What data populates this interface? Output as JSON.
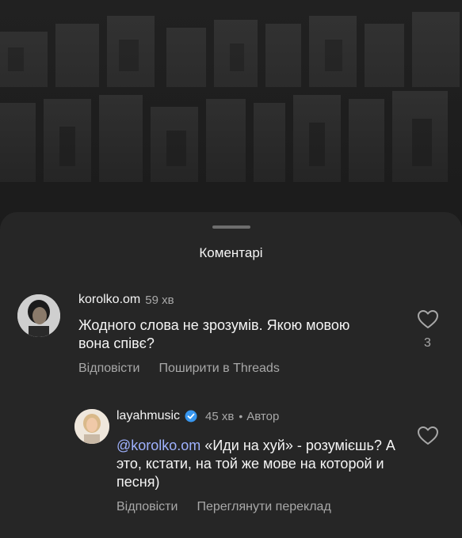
{
  "sheet": {
    "title": "Коментарі"
  },
  "comments": [
    {
      "username": "korolko.om",
      "time": "59 хв",
      "text": "Жодного слова не зрозумів. Якою мовою вона співє?",
      "like_count": "3",
      "actions": [
        "Відповісти",
        "Поширити в Threads"
      ]
    }
  ],
  "reply": {
    "username": "layahmusic",
    "time": "45 хв",
    "author_label": "Автор",
    "separator": "•",
    "mention": "@korolko.om",
    "text": " «Иди на хуй» - розумієшь? А это, кстати, на той же мове на которой и песня)",
    "actions": [
      "Відповісти",
      "Переглянути переклад"
    ]
  },
  "colors": {
    "sheet_bg": "#262626",
    "text_primary": "#f5f5f5",
    "text_secondary": "#a8a8a8",
    "mention": "#9fb2ff",
    "verified": "#3897f0"
  },
  "icons": {
    "like": "heart-outline-icon",
    "verified": "verified-badge-icon"
  }
}
